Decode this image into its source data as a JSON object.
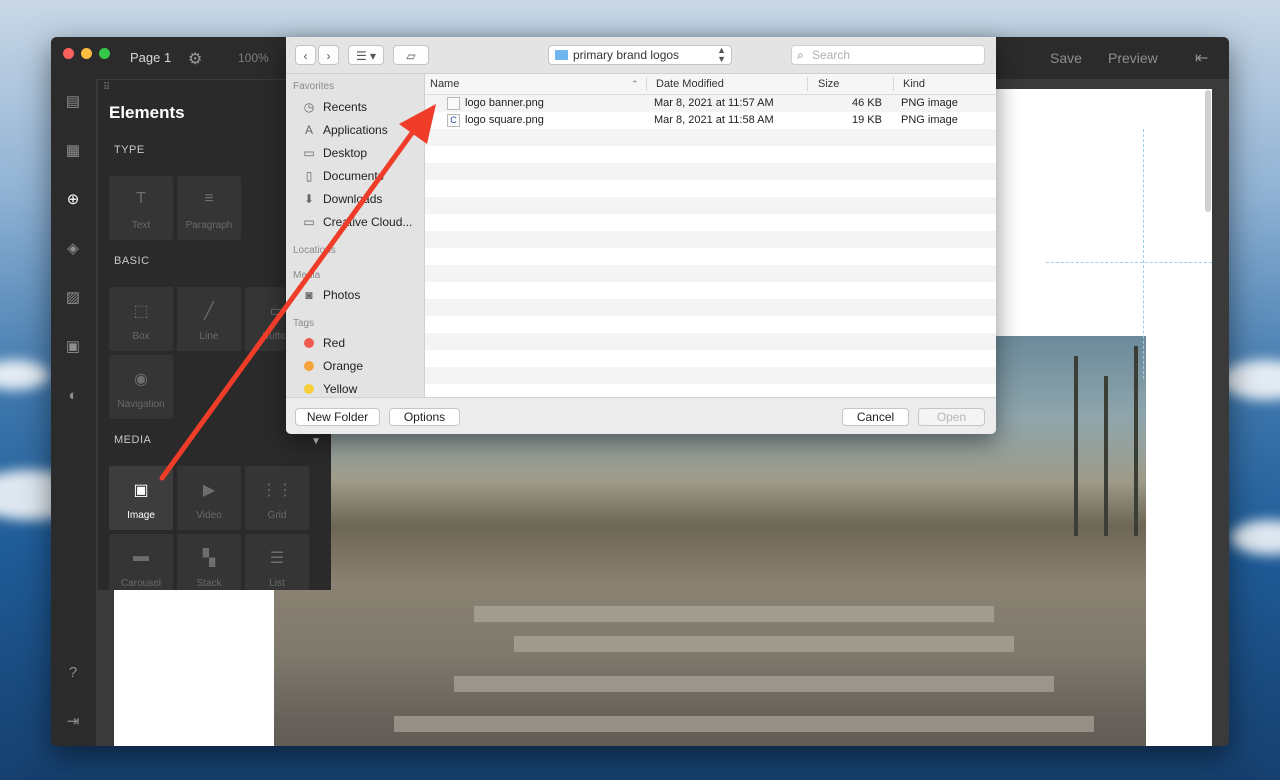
{
  "app": {
    "page_label": "Page 1",
    "zoom": "100%",
    "save_label": "Save",
    "preview_label": "Preview"
  },
  "panel": {
    "title": "Elements",
    "sections": {
      "type": "TYPE",
      "basic": "BASIC",
      "media": "MEDIA"
    },
    "tiles": {
      "text": "Text",
      "paragraph": "Paragraph",
      "box": "Box",
      "line": "Line",
      "button": "Button",
      "navigation": "Navigation",
      "image": "Image",
      "video": "Video",
      "grid": "Grid",
      "carousel": "Carousel",
      "stack": "Stack",
      "list": "List"
    }
  },
  "dialog": {
    "location": "primary brand logos",
    "search_placeholder": "Search",
    "sidebar": {
      "favorites_header": "Favorites",
      "favorites": [
        "Recents",
        "Applications",
        "Desktop",
        "Documents",
        "Downloads",
        "Creative Cloud..."
      ],
      "locations_header": "Locations",
      "media_header": "Media",
      "media": [
        "Photos"
      ],
      "tags_header": "Tags",
      "tags": [
        {
          "name": "Red",
          "color": "#ef5b4f"
        },
        {
          "name": "Orange",
          "color": "#f6a33a"
        },
        {
          "name": "Yellow",
          "color": "#f5cf3a"
        }
      ]
    },
    "columns": {
      "name": "Name",
      "date_modified": "Date Modified",
      "size": "Size",
      "kind": "Kind"
    },
    "files": [
      {
        "name": "logo banner.png",
        "date": "Mar 8, 2021 at 11:57 AM",
        "size": "46 KB",
        "kind": "PNG image"
      },
      {
        "name": "logo square.png",
        "date": "Mar 8, 2021 at 11:58 AM",
        "size": "19 KB",
        "kind": "PNG image"
      }
    ],
    "buttons": {
      "new_folder": "New Folder",
      "options": "Options",
      "cancel": "Cancel",
      "open": "Open"
    }
  },
  "colors": {
    "arrow": "#ef3d2a",
    "traffic_close": "#fc605c",
    "traffic_min": "#fdbc40",
    "traffic_max": "#34c84a"
  }
}
